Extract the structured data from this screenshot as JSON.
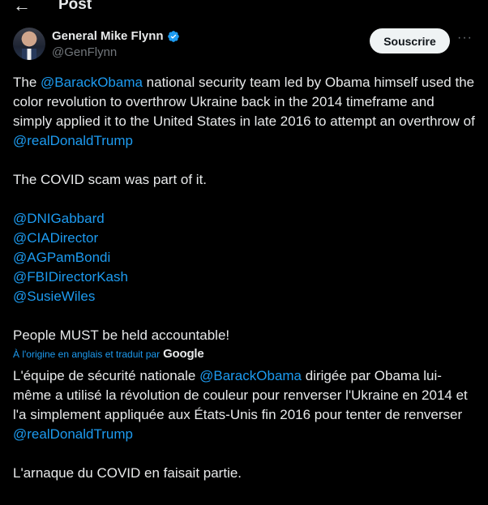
{
  "header": {
    "title": "Post"
  },
  "author": {
    "name": "General Mike Flynn",
    "handle": "@GenFlynn"
  },
  "actions": {
    "subscribe_label": "Souscrire",
    "more_label": "···"
  },
  "tweet": {
    "p1_before": "The ",
    "p1_mention1": "@BarackObama",
    "p1_middle": " national security team led by Obama himself used the color revolution to overthrow Ukraine back in the 2014 timeframe and simply applied it to the United States in late 2016 to attempt an overthrow of ",
    "p1_mention2": "@realDonaldTrump",
    "p2": "The COVID scam was part of it.",
    "mentions": [
      "@DNIGabbard",
      "@CIADirector",
      "@AGPamBondi",
      "@FBIDirectorKash",
      "@SusieWiles"
    ],
    "p3": "People MUST be held accountable!"
  },
  "translation": {
    "notice": "À l'origine en anglais et traduit par",
    "provider": "Google",
    "p1_before": "L'équipe de sécurité nationale ",
    "p1_mention1": "@BarackObama",
    "p1_middle": " dirigée par Obama lui-même a utilisé la révolution de couleur pour renverser l'Ukraine en 2014 et l'a simplement appliquée aux États-Unis fin 2016 pour tenter de renverser ",
    "p1_mention2": "@realDonaldTrump",
    "p2": "L'arnaque du COVID en faisait partie."
  },
  "colors": {
    "background": "#000000",
    "text": "#e7e9ea",
    "link": "#1d9bf0",
    "secondary": "#71767b"
  },
  "icons": {
    "back": "arrow-left-icon",
    "verified": "verified-badge-icon",
    "more": "more-icon"
  }
}
